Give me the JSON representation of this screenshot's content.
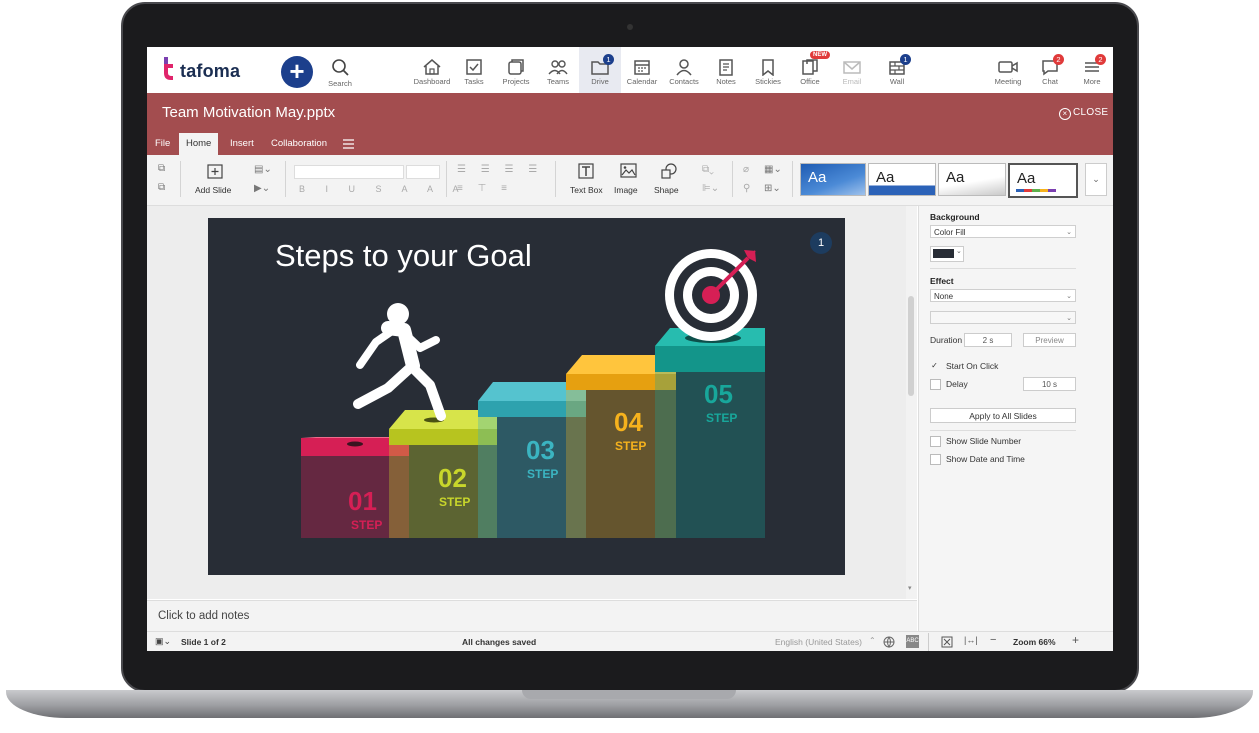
{
  "app": {
    "logo_text": "tafoma"
  },
  "nav": {
    "search_label": "Search",
    "items": [
      {
        "label": "Dashboard",
        "icon": "home-icon"
      },
      {
        "label": "Tasks",
        "icon": "tasks-icon"
      },
      {
        "label": "Projects",
        "icon": "projects-icon"
      },
      {
        "label": "Teams",
        "icon": "teams-icon"
      },
      {
        "label": "Drive",
        "icon": "drive-icon",
        "badge": "1",
        "active": true
      },
      {
        "label": "Calendar",
        "icon": "calendar-icon"
      },
      {
        "label": "Contacts",
        "icon": "contacts-icon"
      },
      {
        "label": "Notes",
        "icon": "notes-icon"
      },
      {
        "label": "Stickies",
        "icon": "stickies-icon"
      },
      {
        "label": "Office",
        "icon": "office-icon",
        "badge": "NEW"
      },
      {
        "label": "Email",
        "icon": "email-icon"
      },
      {
        "label": "Wall",
        "icon": "wall-icon",
        "badge": "1"
      }
    ],
    "right_items": [
      {
        "label": "Meeting",
        "icon": "video-icon"
      },
      {
        "label": "Chat",
        "icon": "chat-icon",
        "badge": "2"
      },
      {
        "label": "More",
        "icon": "menu-icon",
        "badge": "2"
      }
    ]
  },
  "document": {
    "title": "Team Motivation May.pptx",
    "close_label": "CLOSE"
  },
  "menu_tabs": [
    "File",
    "Home",
    "Insert",
    "Collaboration"
  ],
  "toolbar": {
    "add_slide": "Add Slide",
    "text_box": "Text Box",
    "image": "Image",
    "shape": "Shape",
    "theme_label": "Aa"
  },
  "slide": {
    "title": "Steps to your Goal",
    "number": "1",
    "steps": [
      {
        "num": "01",
        "word": "STEP",
        "color": "#d61f55"
      },
      {
        "num": "02",
        "word": "STEP",
        "color": "#c8d62b"
      },
      {
        "num": "03",
        "word": "STEP",
        "color": "#3bb4c1"
      },
      {
        "num": "04",
        "word": "STEP",
        "color": "#f6b21d"
      },
      {
        "num": "05",
        "word": "STEP",
        "color": "#18a79b"
      }
    ]
  },
  "notes_placeholder": "Click to add notes",
  "status": {
    "slide_counter": "Slide 1 of 2",
    "saved": "All changes saved",
    "language": "English (United States)",
    "zoom": "Zoom 66%"
  },
  "panel": {
    "background_heading": "Background",
    "background_value": "Color Fill",
    "effect_heading": "Effect",
    "effect_value": "None",
    "duration_label": "Duration",
    "duration_value": "2 s",
    "preview_label": "Preview",
    "start_on_click": "Start On Click",
    "delay_label": "Delay",
    "delay_value": "10 s",
    "apply_all": "Apply to All Slides",
    "show_slide_number": "Show Slide Number",
    "show_date_time": "Show Date and Time"
  },
  "colors": {
    "accent": "#a34d4f",
    "brand_blue": "#1c3f8c",
    "slide_bg": "#282d36"
  }
}
